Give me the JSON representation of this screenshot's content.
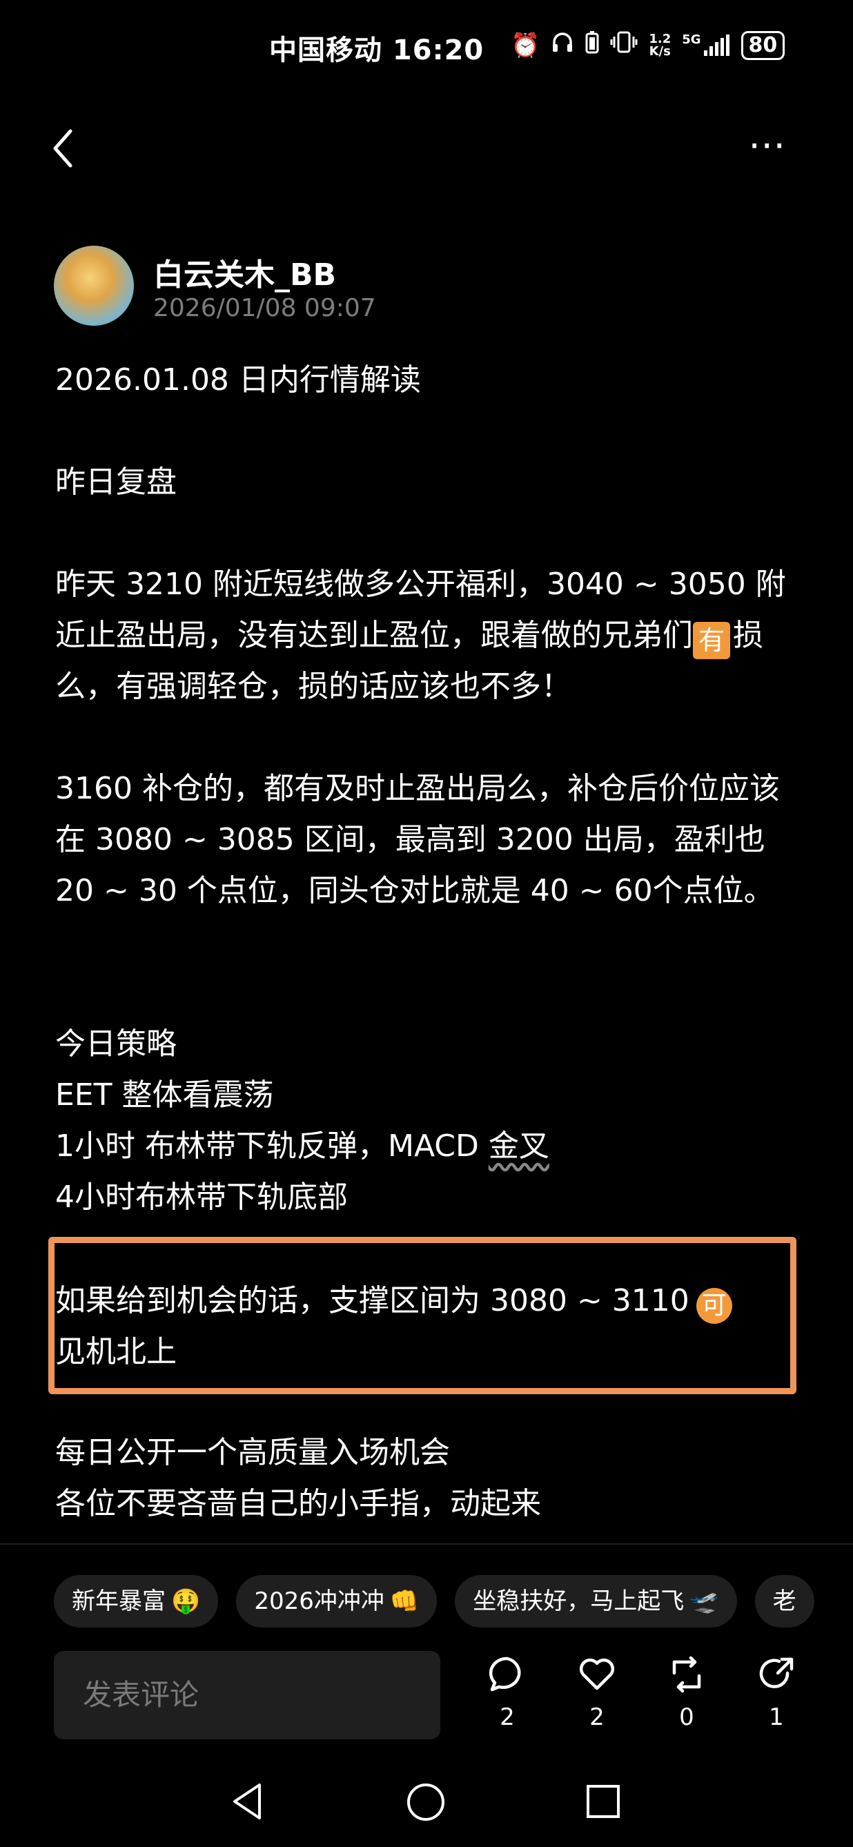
{
  "status_bar": {
    "carrier_time": "中国移动 16:20",
    "net_speed_top": "1.2",
    "net_speed_bottom": "K/s",
    "network": "5G",
    "battery": "80",
    "icons": [
      "alarm-icon",
      "headphones-icon",
      "battery-saver-icon",
      "vibrate-icon",
      "net-speed",
      "signal-5g-icon",
      "battery-icon"
    ]
  },
  "header": {
    "back_icon": "chevron-left-icon",
    "more_icon": "more-horizontal-icon",
    "more_text": "⋯"
  },
  "post": {
    "author": "白云关木_BB",
    "timestamp": "2026/01/08 09:07",
    "title": "2026.01.08 日内行情解读",
    "review_heading": "昨日复盘",
    "review_p1_part1": "昨天 3210 附近短线做多公开福利，3040 ~ 3050 附近止盈出局，没有达到止盈位，跟着做的兄弟们",
    "review_p1_emoji": "有",
    "review_p1_part2": "损么，有强调轻仓，损的话应该也不多！",
    "review_p2": "3160 补仓的，都有及时止盈出局么，补仓后价位应该在 3080 ~ 3085 区间，最高到 3200 出局，盈利也 20 ~ 30 个点位，同头仓对比就是 40 ~ 60个点位。",
    "strategy_heading": "今日策略",
    "strategy_l1": "EET 整体看震荡",
    "strategy_l2_prefix": "1小时 布林带下轨反弹，MACD ",
    "strategy_l2_link": "金叉",
    "strategy_l3": "4小时布林带下轨底部",
    "highlight_text": "如果给到机会的话，支撑区间为 3080 ~ 3110",
    "highlight_emoji": "可",
    "highlight_text2": "见机北上",
    "footer_l1": "每日公开一个高质量入场机会",
    "footer_l2": "各位不要吝啬自己的小手指，动起来"
  },
  "tags": [
    {
      "label": "新年暴富",
      "emoji": "🤑"
    },
    {
      "label": "2026冲冲冲",
      "emoji": "👊"
    },
    {
      "label": "坐稳扶好，马上起飞",
      "emoji": "🛫"
    },
    {
      "label": "老",
      "emoji": ""
    }
  ],
  "actions": {
    "comment_placeholder": "发表评论",
    "comment_count": "2",
    "like_count": "2",
    "repost_count": "0",
    "share_count": "1"
  },
  "colors": {
    "background": "#000000",
    "highlight_border": "#f0955a",
    "emoji_orange": "#f29a3b",
    "muted_text": "#7d7d7d",
    "chip_bg": "#1f1f1f"
  }
}
